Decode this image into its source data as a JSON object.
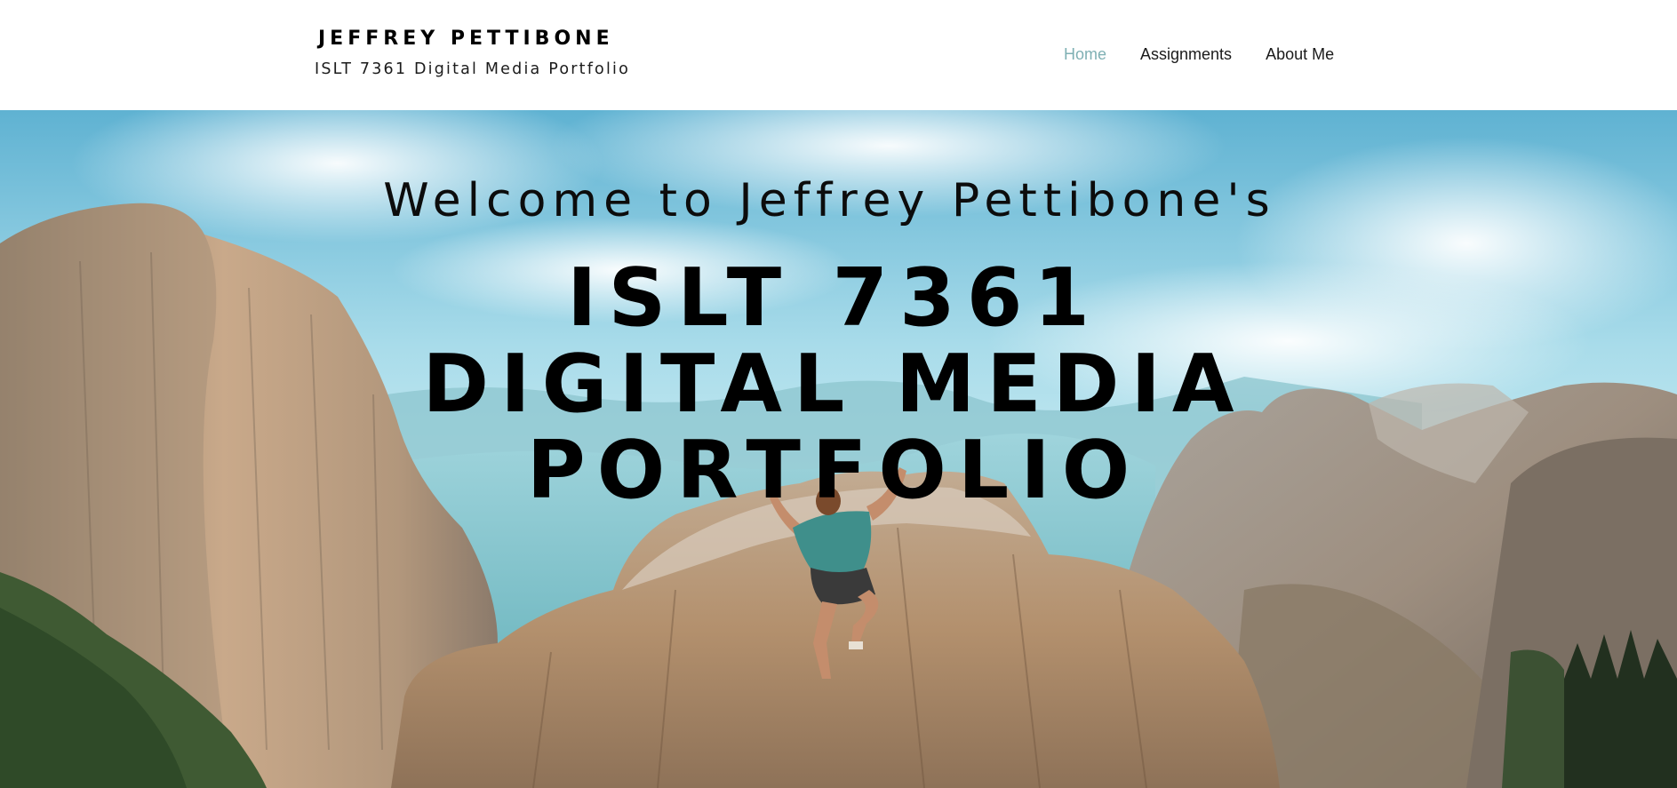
{
  "header": {
    "site_title": "JEFFREY PETTIBONE",
    "site_subtitle": "ISLT 7361 Digital Media Portfolio",
    "nav": [
      {
        "label": "Home",
        "active": true
      },
      {
        "label": "Assignments",
        "active": false
      },
      {
        "label": "About Me",
        "active": false
      }
    ]
  },
  "hero": {
    "welcome": "Welcome to Jeffrey Pettibone's",
    "title_lines": [
      "ISLT 7361",
      "DIGITAL MEDIA",
      "PORTFOLIO"
    ],
    "image": "background photo of a rock climber on a granite cliff with mountains and sky"
  },
  "colors": {
    "nav_active": "#7fb0b4",
    "nav_text": "#1a1a1a",
    "title_text": "#000000",
    "sky": "#7ccbe0"
  }
}
